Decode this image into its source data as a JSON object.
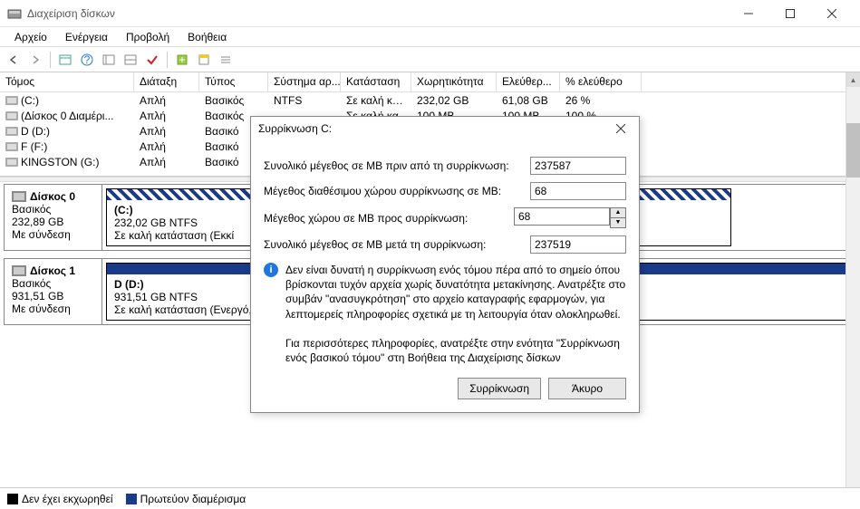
{
  "window": {
    "title": "Διαχείριση δίσκων"
  },
  "menu": {
    "file": "Αρχείο",
    "action": "Ενέργεια",
    "view": "Προβολή",
    "help": "Βοήθεια"
  },
  "columns": {
    "volume": "Τόμος",
    "layout": "Διάταξη",
    "type": "Τύπος",
    "filesystem": "Σύστημα αρ...",
    "status": "Κατάσταση",
    "capacity": "Χωρητικότητα",
    "free": "Ελεύθερ...",
    "pctfree": "% ελεύθερο"
  },
  "volumes": [
    {
      "name": "(C:)",
      "layout": "Απλή",
      "type": "Βασικός",
      "fs": "NTFS",
      "status": "Σε καλή κα...",
      "cap": "232,02 GB",
      "free": "61,08 GB",
      "pct": "26 %"
    },
    {
      "name": "(Δίσκος 0 Διαμέρι...",
      "layout": "Απλή",
      "type": "Βασικός",
      "fs": "",
      "status": "Σε καλή κα",
      "cap": "100 MB",
      "free": "100 MB",
      "pct": "100 %"
    },
    {
      "name": "D (D:)",
      "layout": "Απλή",
      "type": "Βασικό",
      "fs": "",
      "status": "",
      "cap": "",
      "free": "",
      "pct": ""
    },
    {
      "name": "F (F:)",
      "layout": "Απλή",
      "type": "Βασικό",
      "fs": "",
      "status": "",
      "cap": "",
      "free": "",
      "pct": ""
    },
    {
      "name": "KINGSTON (G:)",
      "layout": "Απλή",
      "type": "Βασικό",
      "fs": "",
      "status": "",
      "cap": "",
      "free": "",
      "pct": ""
    }
  ],
  "disks": [
    {
      "title": "Δίσκος 0",
      "type": "Βασικός",
      "size": "232,89 GB",
      "status": "Με σύνδεση",
      "parts": [
        {
          "name": "(C:)",
          "info": "232,02 GB NTFS",
          "status": "Σε καλή κατάσταση (Εκκί",
          "style": "hatch"
        }
      ]
    },
    {
      "title": "Δίσκος 1",
      "type": "Βασικός",
      "size": "931,51 GB",
      "status": "Με σύνδεση",
      "parts": [
        {
          "name": "D  (D:)",
          "info": "931,51 GB NTFS",
          "status": "Σε καλή κατάσταση (Ενεργό, Πρωτεύον διαμέρισμα)",
          "style": "solidblue"
        }
      ]
    }
  ],
  "legend": {
    "unallocated": "Δεν έχει εκχωρηθεί",
    "primary": "Πρωτεύον διαμέρισμα"
  },
  "dialog": {
    "title": "Συρρίκνωση C:",
    "labels": {
      "total_before": "Συνολικό μέγεθος σε MB πριν από τη συρρίκνωση:",
      "available": "Μέγεθος διαθέσιμου χώρου συρρίκνωσης σε MB:",
      "to_shrink": "Μέγεθος χώρου σε MB προς συρρίκνωση:",
      "total_after": "Συνολικό μέγεθος σε MB μετά τη συρρίκνωση:"
    },
    "values": {
      "total_before": "237587",
      "available": "68",
      "to_shrink": "68",
      "total_after": "237519"
    },
    "info1": "Δεν είναι δυνατή η συρρίκνωση ενός τόμου πέρα από το σημείο όπου βρίσκονται τυχόν αρχεία χωρίς δυνατότητα μετακίνησης. Ανατρέξτε στο συμβάν \"ανασυγκρότηση\" στο αρχείο καταγραφής εφαρμογών, για λεπτομερείς πληροφορίες σχετικά με τη λειτουργία όταν ολοκληρωθεί.",
    "info2": "Για περισσότερες πληροφορίες, ανατρέξτε στην ενότητα \"Συρρίκνωση ενός βασικού τόμου\" στη Βοήθεια της Διαχείρισης δίσκων",
    "buttons": {
      "shrink": "Συρρίκνωση",
      "cancel": "Άκυρο"
    }
  }
}
